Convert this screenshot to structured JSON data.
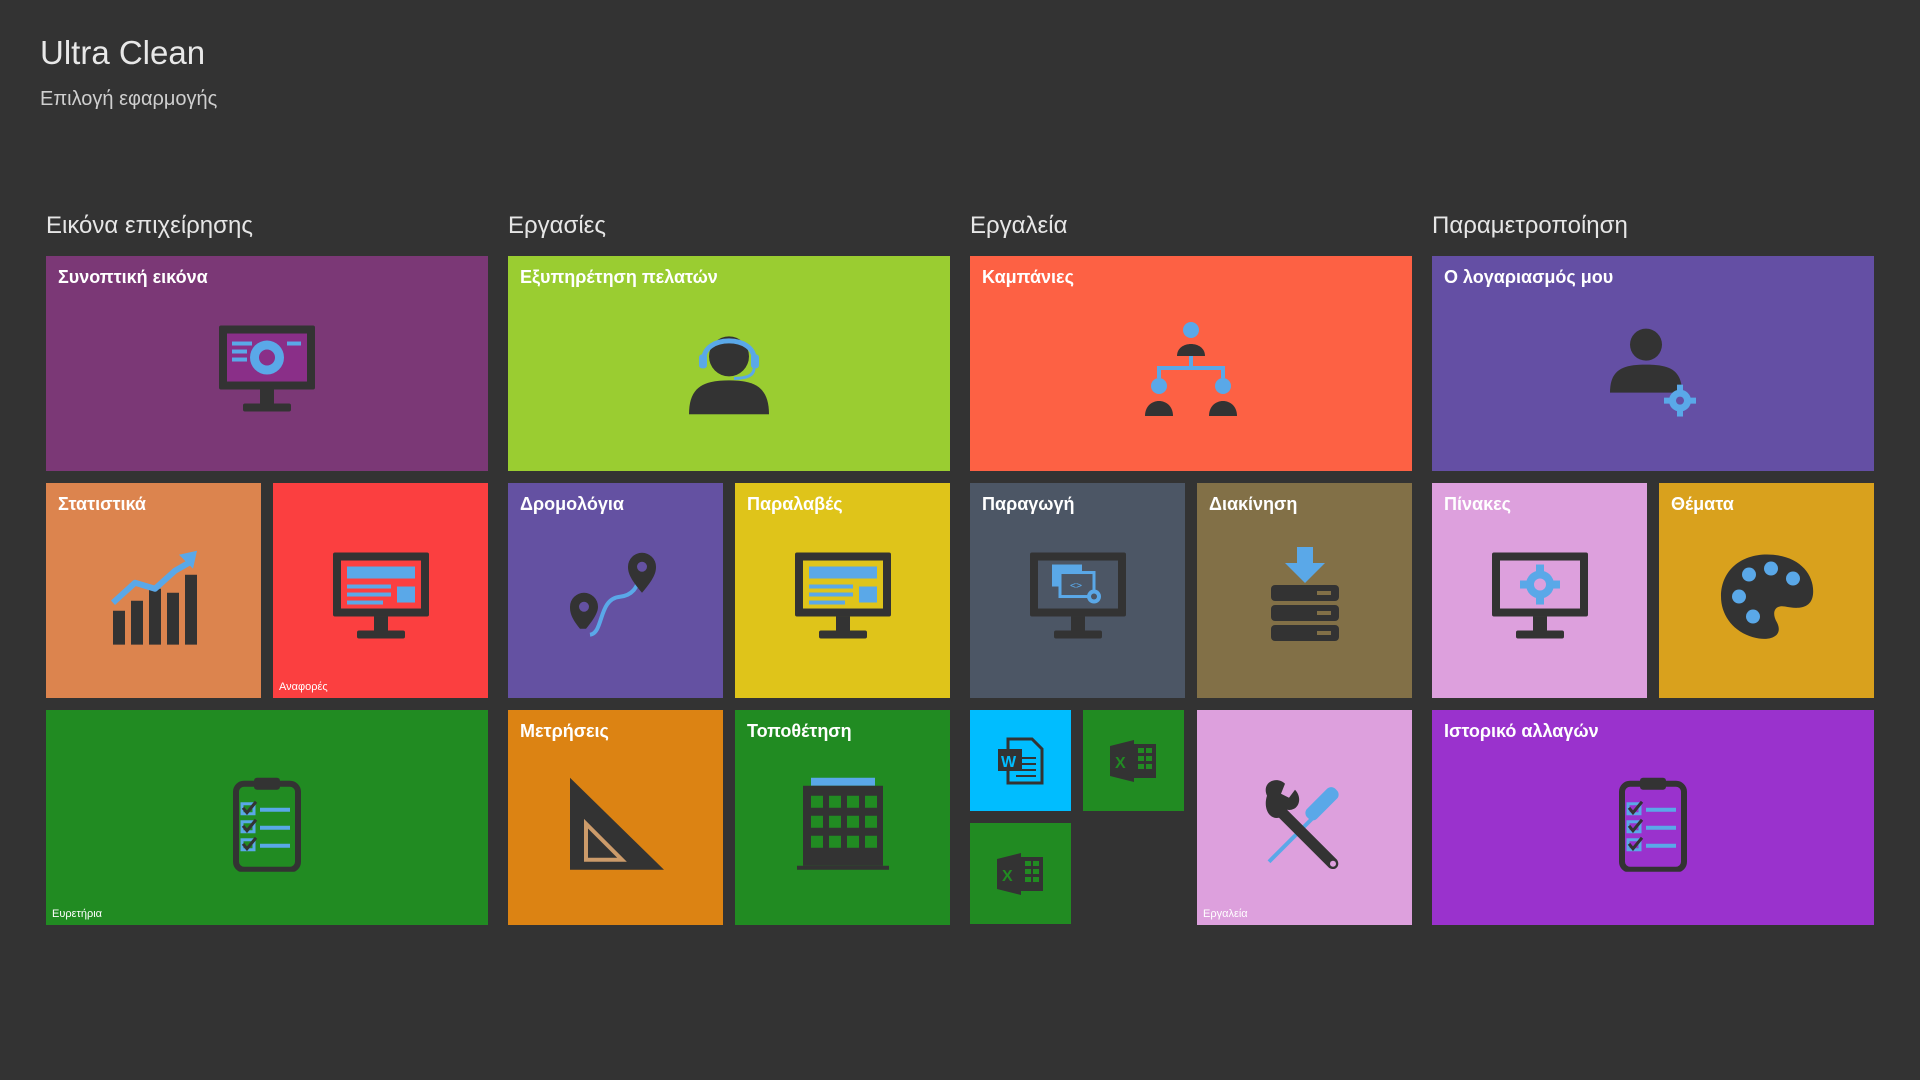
{
  "app": {
    "title": "Ultra Clean",
    "subtitle": "Επιλογή εφαρμογής"
  },
  "groups": {
    "business": {
      "title": "Εικόνα επιχείρησης",
      "overview": {
        "label": "Συνοπτική εικόνα",
        "color": "#7b3876",
        "icon": "monitor-chart-icon"
      },
      "statistics": {
        "label": "Στατιστικά",
        "color": "#dc844e",
        "icon": "growth-chart-icon"
      },
      "reports": {
        "label": "Αναφορές",
        "color": "#fb3f40",
        "icon": "monitor-report-icon"
      },
      "index": {
        "label": "Ευρετήρια",
        "color": "#218b22",
        "icon": "checklist-icon"
      }
    },
    "tasks": {
      "title": "Εργασίες",
      "customer_service": {
        "label": "Εξυπηρέτηση πελατών",
        "color": "#9acd31",
        "icon": "headset-agent-icon"
      },
      "routes": {
        "label": "Δρομολόγια",
        "color": "#6451a2",
        "icon": "route-pins-icon"
      },
      "receipts": {
        "label": "Παραλαβές",
        "color": "#dfc41a",
        "icon": "monitor-form-icon"
      },
      "measurements": {
        "label": "Μετρήσεις",
        "color": "#dc8313",
        "icon": "set-square-icon"
      },
      "placement": {
        "label": "Τοποθέτηση",
        "color": "#218b22",
        "icon": "building-icon"
      }
    },
    "tools": {
      "title": "Εργαλεία",
      "campaigns": {
        "label": "Καμπάνιες",
        "color": "#fd6144",
        "icon": "org-chart-icon"
      },
      "production": {
        "label": "Παραγωγή",
        "color": "#4c5665",
        "icon": "monitor-code-icon"
      },
      "movement": {
        "label": "Διακίνηση",
        "color": "#827047",
        "icon": "server-download-icon"
      },
      "word": {
        "label": "",
        "color": "#00bdff",
        "icon": "word-document-icon"
      },
      "excel_1": {
        "label": "",
        "color": "#218b22",
        "icon": "excel-document-icon"
      },
      "excel_2": {
        "label": "",
        "color": "#218b22",
        "icon": "excel-document-icon"
      },
      "tools_tile": {
        "label": "Εργαλεία",
        "color": "#dda0dd",
        "icon": "wrench-screwdriver-icon"
      }
    },
    "settings": {
      "title": "Παραμετροποίηση",
      "account": {
        "label": "Ο λογαριασμός μου",
        "color": "#644fa4",
        "icon": "user-settings-icon"
      },
      "tables": {
        "label": "Πίνακες",
        "color": "#dda0dd",
        "icon": "monitor-gear-icon"
      },
      "themes": {
        "label": "Θέματα",
        "color": "#d9a11d",
        "icon": "palette-icon"
      },
      "change_history": {
        "label": "Ιστορικό αλλαγών",
        "color": "#9a32cd",
        "icon": "checklist-icon"
      }
    }
  }
}
